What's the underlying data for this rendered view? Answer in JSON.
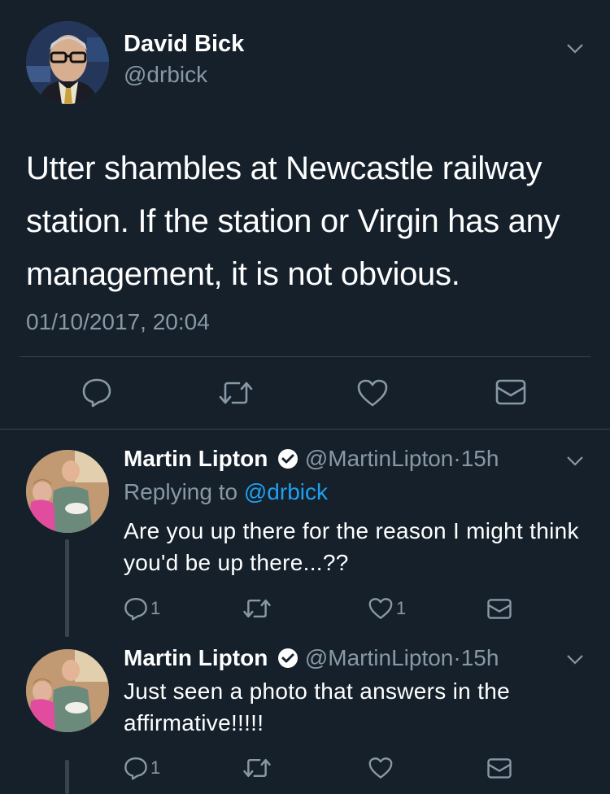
{
  "main_tweet": {
    "name": "David Bick",
    "handle": "@drbick",
    "text": "Utter shambles at Newcastle railway station. If the station or Virgin has any management, it is not obvious.",
    "timestamp": "01/10/2017, 20:04"
  },
  "replies": [
    {
      "name": "Martin Lipton",
      "handle": "@MartinLipton",
      "time": "15h",
      "replying_label": "Replying to",
      "replying_to": "@drbick",
      "text": "Are you up there for the reason I might think you'd be up there...??",
      "reply_count": "1",
      "like_count": "1"
    },
    {
      "name": "Martin Lipton",
      "handle": "@MartinLipton",
      "time": "15h",
      "text": "Just seen a photo that answers in the affirmative!!!!!",
      "reply_count": "1"
    }
  ],
  "separator": "·",
  "colors": {
    "background": "#15202b",
    "muted": "#8899a6",
    "accent": "#1da1f2",
    "divider": "#38444d"
  },
  "icons": [
    "reply-icon",
    "retweet-icon",
    "like-icon",
    "share-icon",
    "chevron-down-icon",
    "verified-icon"
  ]
}
